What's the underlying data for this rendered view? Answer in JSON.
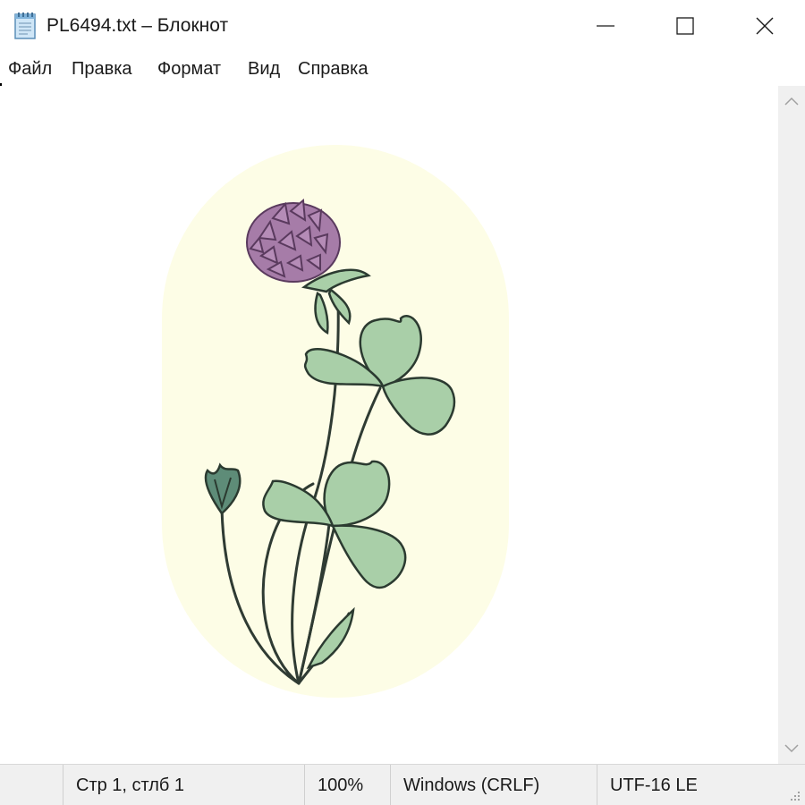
{
  "window": {
    "title": "PL6494.txt – Блокнот"
  },
  "menu": {
    "items": [
      "Файл",
      "Правка",
      "Формат",
      "Вид",
      "Справка"
    ]
  },
  "statusbar": {
    "position": "Стр 1, стлб 1",
    "zoom": "100%",
    "line_ending": "Windows (CRLF)",
    "encoding": "UTF-16 LE"
  },
  "icons": {
    "app": "notepad-icon",
    "minimize": "minimize-icon",
    "maximize": "maximize-icon",
    "close": "close-icon",
    "scroll_up": "chevron-up-icon",
    "scroll_down": "chevron-down-icon",
    "resize": "resize-grip-icon"
  },
  "colors": {
    "background_oval": "#fdfde6",
    "clover_flower": "#a67ca8",
    "clover_flower_dark": "#5a3a5e",
    "leaf_green": "#a9cfa8",
    "leaf_dark": "#2b3a30",
    "stem": "#2f3b33"
  }
}
